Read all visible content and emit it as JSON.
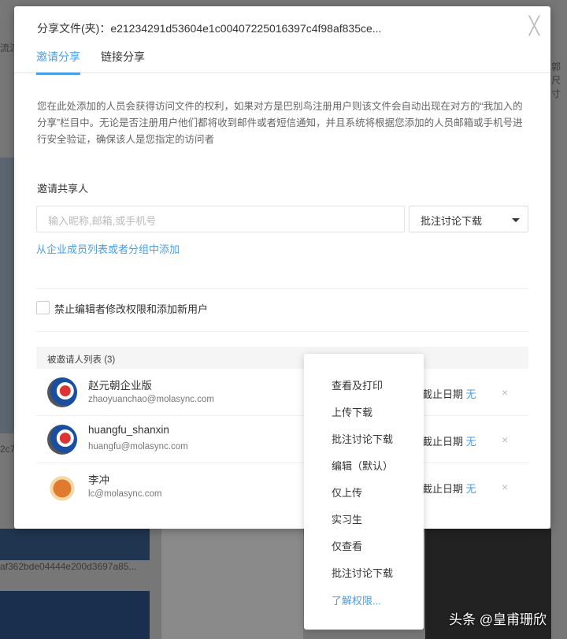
{
  "background": {
    "left_text_1": "流派",
    "right_text_1": "郭尺寸",
    "file_name": "af362bde04444e200d3697a85...",
    "left_text_2": "2c7"
  },
  "dialog": {
    "title": "分享文件(夹)：e21234291d53604e1c00407225016397c4f98af835ce...",
    "tabs": [
      {
        "label": "邀请分享",
        "active": true
      },
      {
        "label": "链接分享",
        "active": false
      }
    ],
    "description": "您在此处添加的人员会获得访问文件的权利，如果对方是巴别鸟注册用户则该文件会自动出现在对方的“我加入的分享”栏目中。无论是否注册用户他们都将收到邮件或者短信通知，并且系统将根据您添加的人员邮箱或手机号进行安全验证，确保该人是您指定的访问者",
    "invite_label": "邀请共享人",
    "invite_placeholder": "输入昵称,邮箱,或手机号",
    "permission_selected": "批注讨论下载",
    "add_from_org": "从企业成员列表或者分组中添加",
    "restrict_checkbox": "禁止编辑者修改权限和添加新用户",
    "invitee_list_header": "被邀请人列表 (3)",
    "invitees": [
      {
        "name": "赵元朝企业版",
        "email": "zhaoyuanchao@molasync.com",
        "expiry_label": "截止日期",
        "expiry_value": "无"
      },
      {
        "name": "huangfu_shanxin",
        "email": "huangfu@molasync.com",
        "expiry_label": "截止日期",
        "expiry_value": "无"
      },
      {
        "name": "李冲",
        "email": "lc@molasync.com",
        "expiry_label": "截止日期",
        "expiry_value": "无"
      }
    ],
    "remove_glyph": "×",
    "close_glyph": "╳"
  },
  "permission_menu": {
    "items": [
      "查看及打印",
      "上传下载",
      "批注讨论下载",
      "编辑（默认）",
      "仅上传",
      "实习生",
      "仅查看",
      "批注讨论下载"
    ],
    "learn_more": "了解权限..."
  },
  "watermark": "头条 @皇甫珊欣"
}
